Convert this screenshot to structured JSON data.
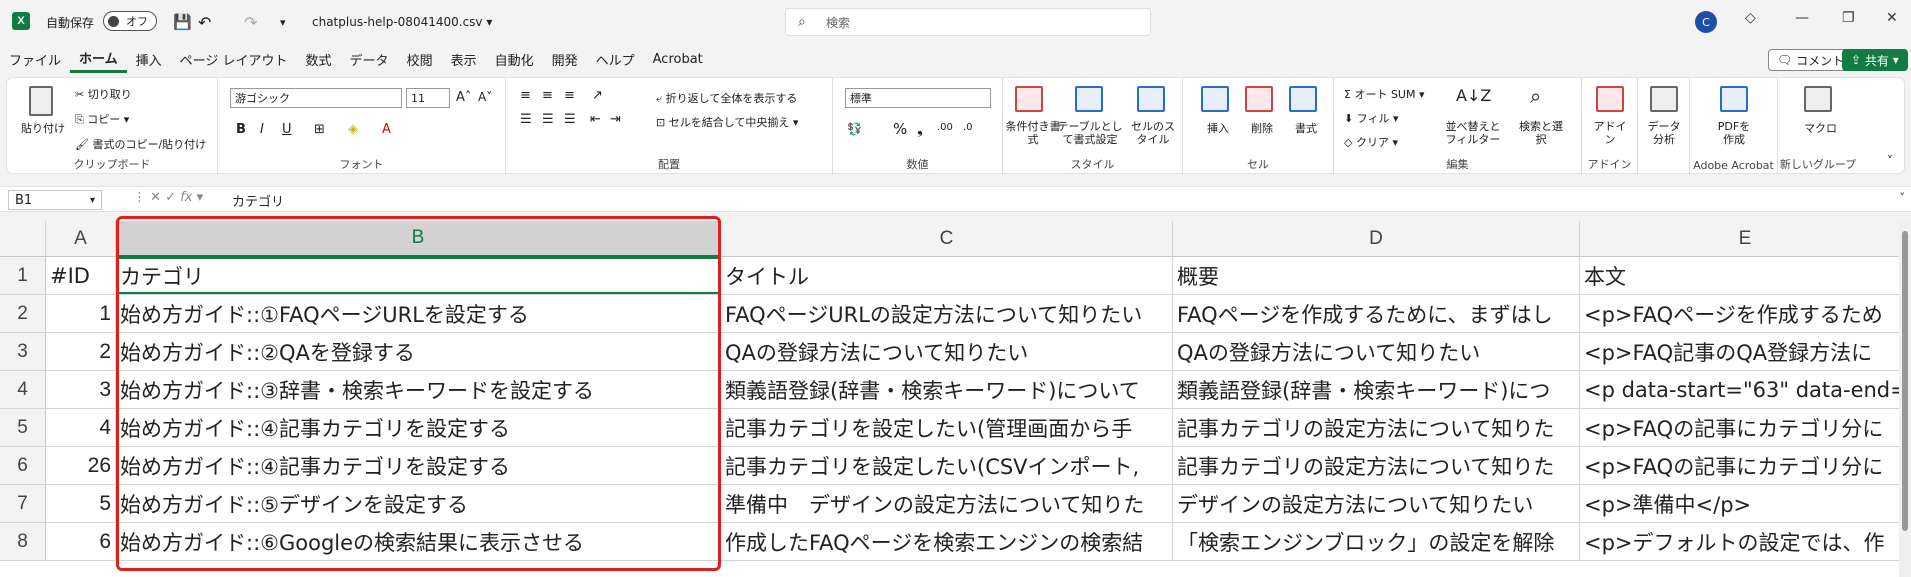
{
  "titlebar": {
    "autosave_label": "自動保存",
    "autosave_state": "オフ",
    "filename": "chatplus-help-08041400.csv",
    "search_placeholder": "検索",
    "avatar_initial": "C"
  },
  "menubar": {
    "items": [
      "ファイル",
      "ホーム",
      "挿入",
      "ページ レイアウト",
      "数式",
      "データ",
      "校閲",
      "表示",
      "自動化",
      "開発",
      "ヘルプ",
      "Acrobat"
    ],
    "comment_label": "コメント",
    "share_label": "共有"
  },
  "ribbon": {
    "clipboard": {
      "paste": "貼り付け",
      "cut": "切り取り",
      "copy": "コピー",
      "format_painter": "書式のコピー/貼り付け",
      "label": "クリップボード"
    },
    "font": {
      "name": "游ゴシック",
      "size": "11",
      "label": "フォント"
    },
    "alignment": {
      "wrap": "折り返して全体を表示する",
      "merge": "セルを結合して中央揃え",
      "label": "配置"
    },
    "number": {
      "format": "標準",
      "label": "数値"
    },
    "styles": {
      "conditional": "条件付き書式",
      "table": "テーブルとして書式設定",
      "cell": "セルのスタイル",
      "label": "スタイル"
    },
    "cells": {
      "insert": "挿入",
      "delete": "削除",
      "format": "書式",
      "label": "セル"
    },
    "editing": {
      "autosum": "オート SUM",
      "fill": "フィル",
      "clear": "クリア",
      "sort": "並べ替えとフィルター",
      "find": "検索と選択",
      "label": "編集"
    },
    "addins": {
      "addin": "アドイン",
      "label": "アドイン"
    },
    "analysis": {
      "data": "データ分析"
    },
    "acrobat": {
      "pdf": "PDFを作成",
      "label": "Adobe Acrobat"
    },
    "newgroup": {
      "macro": "マクロ",
      "label": "新しいグループ"
    }
  },
  "formulabar": {
    "cell_ref": "B1",
    "content": "カテゴリ"
  },
  "grid": {
    "columns": [
      "A",
      "B",
      "C",
      "D",
      "E"
    ],
    "rows": [
      "1",
      "2",
      "3",
      "4",
      "5",
      "6",
      "7",
      "8"
    ],
    "cells": [
      [
        "#ID",
        "カテゴリ",
        "タイトル",
        "概要",
        "本文"
      ],
      [
        "1",
        "始め方ガイド::①FAQページURLを設定する",
        "FAQページURLの設定方法について知りたい",
        "FAQページを作成するために、まずはし",
        "<p>FAQページを作成するため"
      ],
      [
        "2",
        "始め方ガイド::②QAを登録する",
        "QAの登録方法について知りたい",
        "QAの登録方法について知りたい",
        "<p>FAQ記事のQA登録方法に"
      ],
      [
        "3",
        "始め方ガイド::③辞書・検索キーワードを設定する",
        "類義語登録(辞書・検索キーワード)について",
        "類義語登録(辞書・検索キーワード)につ",
        "<p data-start=\"63\" data-end="
      ],
      [
        "4",
        "始め方ガイド::④記事カテゴリを設定する",
        "記事カテゴリを設定したい(管理画面から手",
        "記事カテゴリの設定方法について知りた",
        "<p>FAQの記事にカテゴリ分に"
      ],
      [
        "26",
        "始め方ガイド::④記事カテゴリを設定する",
        "記事カテゴリを設定したい(CSVインポート,",
        "記事カテゴリの設定方法について知りた",
        "<p>FAQの記事にカテゴリ分に"
      ],
      [
        "5",
        "始め方ガイド::⑤デザインを設定する",
        "準備中　デザインの設定方法について知りた",
        "デザインの設定方法について知りたい",
        "<p>準備中</p>"
      ],
      [
        "6",
        "始め方ガイド::⑥Googleの検索結果に表示させる",
        "作成したFAQページを検索エンジンの検索結",
        "「検索エンジンブロック」の設定を解除",
        "<p>デフォルトの設定では、作"
      ]
    ]
  }
}
